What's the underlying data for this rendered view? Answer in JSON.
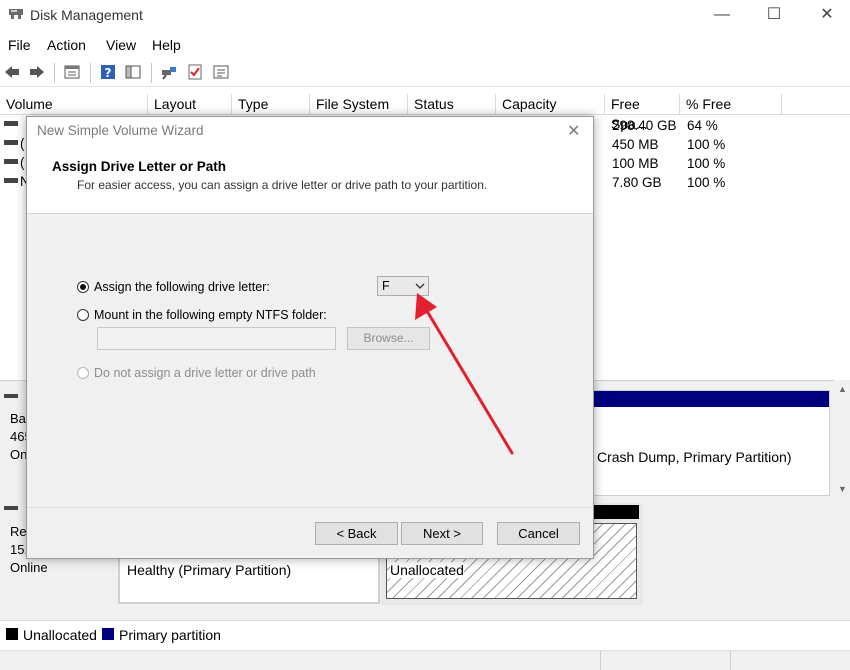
{
  "window": {
    "title": "Disk Management",
    "minimize_glyph": "—",
    "maximize_glyph": "☐",
    "close_glyph": "✕"
  },
  "menu": [
    "File",
    "Action",
    "View",
    "Help"
  ],
  "toolbar_icons": [
    "back-icon",
    "forward-icon",
    "properties-icon",
    "help-icon",
    "console-tree-icon",
    "connect-icon",
    "check-icon",
    "list-icon"
  ],
  "volume_list": {
    "columns": [
      "Volume",
      "Layout",
      "Type",
      "File System",
      "Status",
      "Capacity",
      "Free Spa...",
      "% Free"
    ],
    "rows": [
      {
        "volume": "",
        "free": "298.40 GB",
        "pct": "64 %"
      },
      {
        "volume": "(",
        "free": "450 MB",
        "pct": "100 %"
      },
      {
        "volume": "(",
        "free": "100 MB",
        "pct": "100 %"
      },
      {
        "volume": "N",
        "free": "7.80 GB",
        "pct": "100 %"
      }
    ]
  },
  "disk0": {
    "label_lines": [
      "Ba",
      "465",
      "On"
    ],
    "partition_text": "Crash Dump, Primary Partition)"
  },
  "disk1": {
    "label_lines": [
      "Re",
      "15.",
      "Online"
    ],
    "partition1_text": "Healthy (Primary Partition)",
    "partition2_text": "Unallocated"
  },
  "legend": [
    {
      "label": "Unallocated",
      "color": "#000000"
    },
    {
      "label": "Primary partition",
      "color": "#00007f"
    }
  ],
  "wizard": {
    "title": "New Simple Volume Wizard",
    "close_glyph": "✕",
    "heading": "Assign Drive Letter or Path",
    "subheading": "For easier access, you can assign a drive letter or drive path to your partition.",
    "option_assign": "Assign the following drive letter:",
    "option_mount": "Mount in the following empty NTFS folder:",
    "option_none": "Do not assign a drive letter or drive path",
    "drive_letter": "F",
    "folder_value": "",
    "browse_label": "Browse...",
    "back_label": "< Back",
    "next_label": "Next >",
    "cancel_label": "Cancel"
  },
  "colors": {
    "primary_partition": "#00007f",
    "annotation_arrow": "#e3202e"
  }
}
